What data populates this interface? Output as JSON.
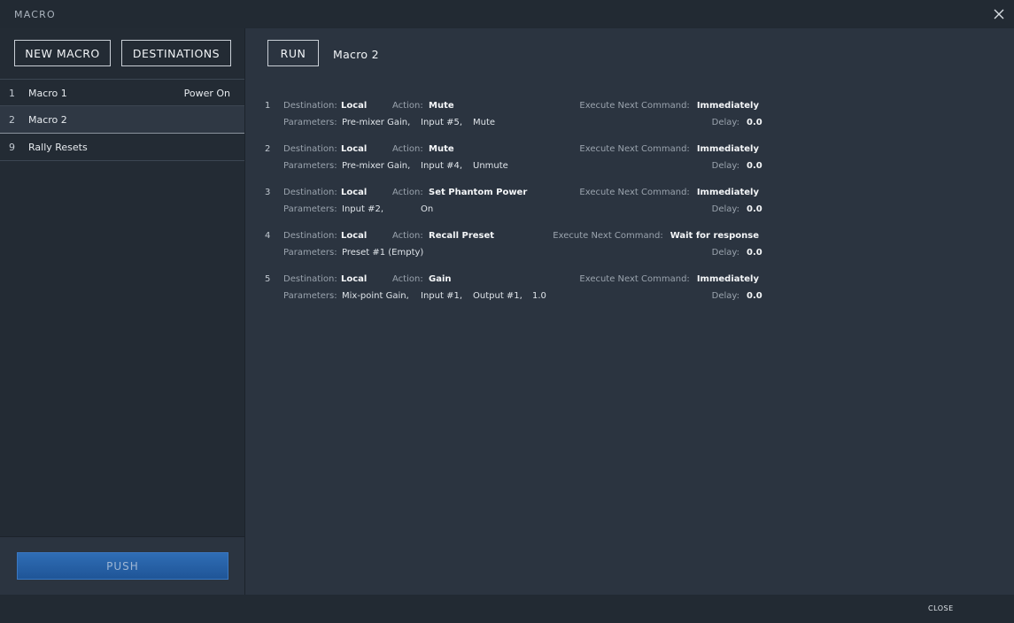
{
  "window": {
    "title": "MACRO",
    "close_label": "CLOSE"
  },
  "sidebar": {
    "new_macro_label": "NEW MACRO",
    "destinations_label": "DESTINATIONS",
    "macros": [
      {
        "num": "1",
        "name": "Macro 1",
        "trigger": "Power On"
      },
      {
        "num": "2",
        "name": "Macro 2",
        "trigger": ""
      },
      {
        "num": "9",
        "name": "Rally Resets",
        "trigger": ""
      }
    ],
    "selected_index": 1,
    "push_label": "PUSH"
  },
  "main": {
    "run_label": "RUN",
    "macro_name": "Macro 2",
    "labels": {
      "destination": "Destination:",
      "action": "Action:",
      "parameters": "Parameters:",
      "execute_next": "Execute Next Command:",
      "delay": "Delay:"
    },
    "commands": [
      {
        "index": "1",
        "destination": "Local",
        "action": "Mute",
        "params": [
          "Pre-mixer Gain,",
          "Input #5,",
          "Mute"
        ],
        "execute": "Immediately",
        "delay": "0.0"
      },
      {
        "index": "2",
        "destination": "Local",
        "action": "Mute",
        "params": [
          "Pre-mixer Gain,",
          "Input #4,",
          "Unmute"
        ],
        "execute": "Immediately",
        "delay": "0.0"
      },
      {
        "index": "3",
        "destination": "Local",
        "action": "Set Phantom Power",
        "params": [
          "Input #2,",
          "On"
        ],
        "execute": "Immediately",
        "delay": "0.0"
      },
      {
        "index": "4",
        "destination": "Local",
        "action": "Recall Preset",
        "params": [
          "Preset #1 (Empty)"
        ],
        "execute": "Wait for response",
        "delay": "0.0"
      },
      {
        "index": "5",
        "destination": "Local",
        "action": "Gain",
        "params": [
          "Mix-point Gain,",
          "Input #1,",
          "Output #1,",
          "1.0"
        ],
        "execute": "Immediately",
        "delay": "0.0"
      }
    ]
  }
}
